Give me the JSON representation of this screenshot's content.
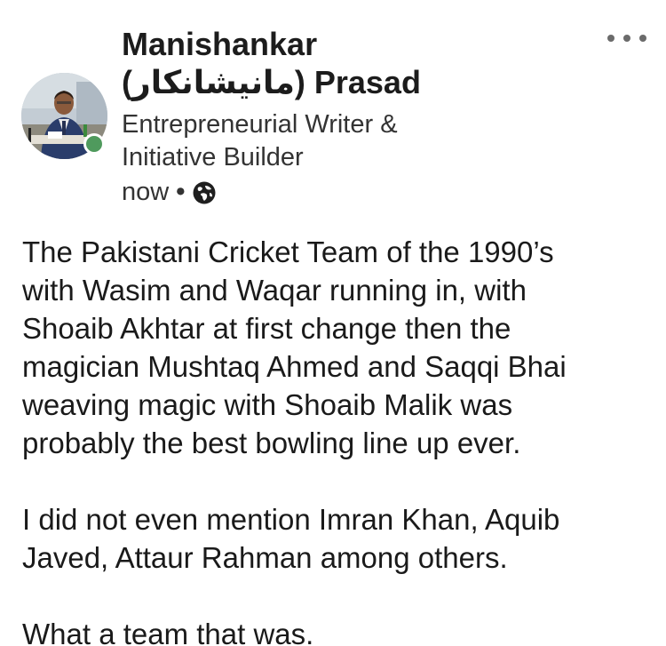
{
  "author": {
    "name_line1": "Manishankar",
    "name_line2": "(مانیشانکار) Prasad",
    "headline_line1": "Entrepreneurial Writer &",
    "headline_line2": "Initiative Builder",
    "timestamp": "now",
    "separator": "•",
    "visibility_icon": "globe-icon",
    "online_status": "online",
    "online_color": "#4f9a5d"
  },
  "more_menu": {
    "icon": "more-horizontal-icon"
  },
  "post": {
    "paragraph1": [
      "The Pakistani Cricket Team of the 1990’s",
      "with Wasim and Waqar running in, with",
      "Shoaib Akhtar at first change then the",
      "magician Mushtaq Ahmed and Saqqi Bhai",
      "weaving magic with Shoaib Malik was",
      "probably the best bowling line up ever."
    ],
    "paragraph2": [
      "I did not even mention Imran Khan, Aquib",
      "Javed, Attaur Rahman among others."
    ],
    "paragraph3": [
      "What a team that was."
    ]
  }
}
